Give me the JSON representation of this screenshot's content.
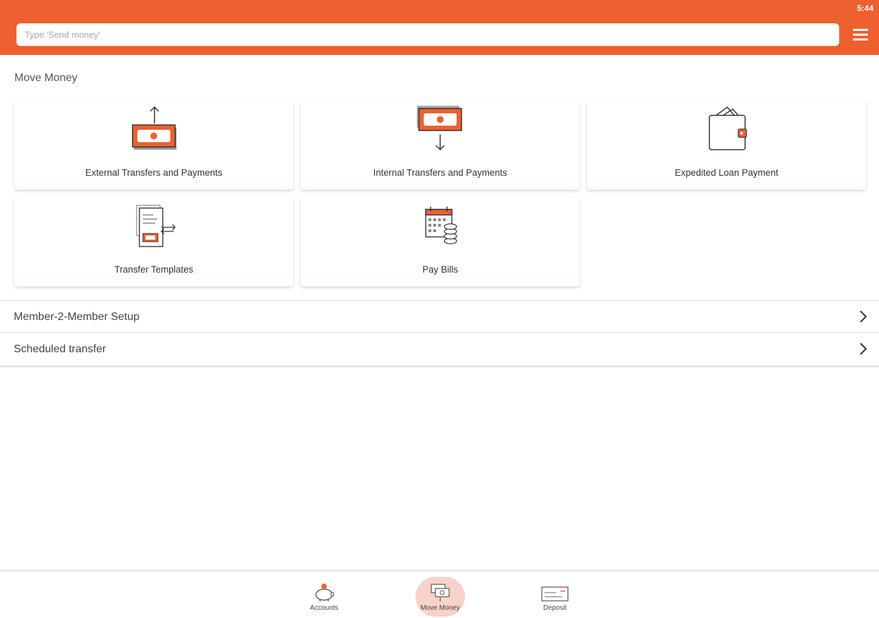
{
  "status_bar": {
    "time": "5:44"
  },
  "header": {
    "search_placeholder": "Type 'Send money'",
    "search_value": "",
    "menu_icon": "hamburger-menu-icon"
  },
  "move_money": {
    "title": "Move Money",
    "tiles": [
      {
        "label": "External Transfers and Payments",
        "icon": "external-transfer-icon"
      },
      {
        "label": "Internal Transfers and Payments",
        "icon": "internal-transfer-icon"
      },
      {
        "label": "Expedited Loan Payment",
        "icon": "wallet-icon"
      },
      {
        "label": "Transfer Templates",
        "icon": "transfer-template-icon"
      },
      {
        "label": "Pay Bills",
        "icon": "pay-bills-icon"
      }
    ]
  },
  "list": [
    {
      "label": "Member-2-Member Setup",
      "icon": "chevron-right-icon"
    },
    {
      "label": "Scheduled transfer",
      "icon": "chevron-right-icon"
    }
  ],
  "bottom_nav": {
    "active": "Move Money",
    "items": [
      {
        "label": "Accounts",
        "icon": "piggy-bank-icon"
      },
      {
        "label": "Move Money",
        "icon": "move-money-icon"
      },
      {
        "label": "Deposit",
        "icon": "check-deposit-icon"
      }
    ]
  },
  "colors": {
    "brand": "#ee6030",
    "active_nav_background": "#f8d2c8",
    "icon_outline": "#333333"
  }
}
